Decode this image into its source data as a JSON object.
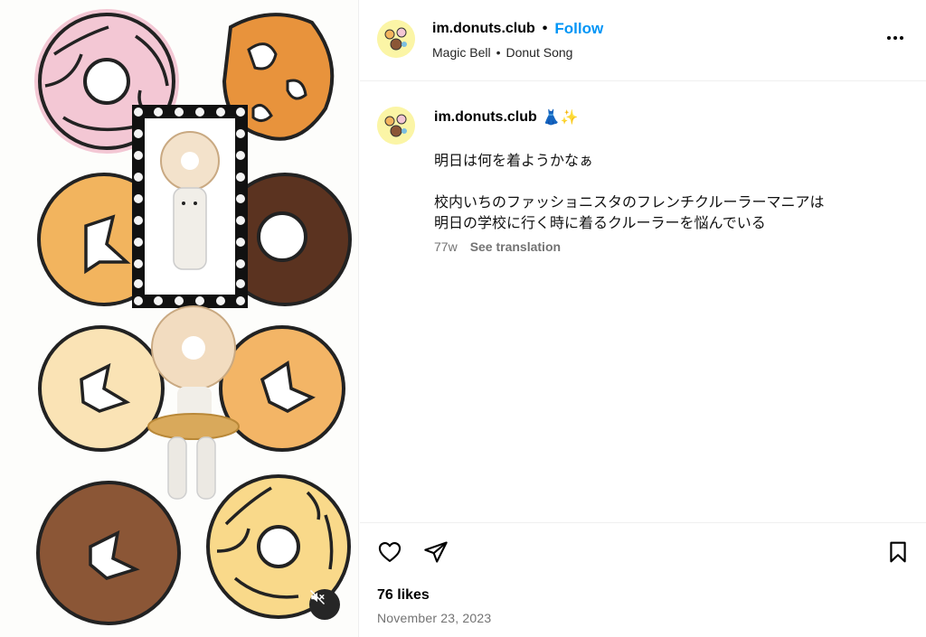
{
  "post": {
    "username": "im.donuts.club",
    "separator": "•",
    "follow_label": "Follow",
    "audio_artist": "Magic Bell",
    "audio_separator": "•",
    "audio_title": "Donut Song",
    "more_icon": "more-horizontal-icon"
  },
  "caption": {
    "username": "im.donuts.club",
    "emojis": "👗✨",
    "text": "明日は何を着ようかなぁ\n\n校内いちのファッショニスタのフレンチクルーラーマニアは\n明日の学校に行く時に着るクルーラーを悩んでいる",
    "age": "77w",
    "see_translation": "See translation"
  },
  "actions": {
    "like_icon": "heart-icon",
    "share_icon": "send-icon",
    "save_icon": "bookmark-icon",
    "likes": "76 likes",
    "date": "November 23, 2023"
  },
  "media": {
    "mute_icon": "volume-muted-icon"
  }
}
